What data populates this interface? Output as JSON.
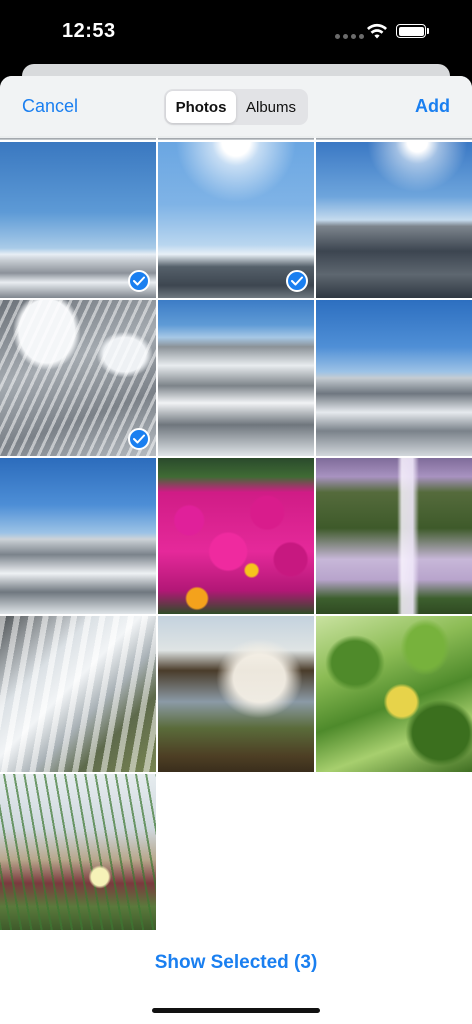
{
  "status_bar": {
    "time": "12:53",
    "icons": [
      "signal-dots-icon",
      "wifi-icon",
      "battery-icon"
    ]
  },
  "nav": {
    "cancel_label": "Cancel",
    "add_label": "Add",
    "segments": [
      {
        "label": "Photos",
        "selected": true
      },
      {
        "label": "Albums",
        "selected": false
      }
    ]
  },
  "photos": [
    {
      "subject": "winter aerial sky",
      "selected": true
    },
    {
      "subject": "winter aerial sun",
      "selected": true
    },
    {
      "subject": "snowy forest horizon",
      "selected": false
    },
    {
      "subject": "snowy forest river",
      "selected": true
    },
    {
      "subject": "aerial snowy fields",
      "selected": false
    },
    {
      "subject": "aerial snowy valley",
      "selected": false
    },
    {
      "subject": "aerial snowy town",
      "selected": false
    },
    {
      "subject": "pink flowers",
      "selected": false
    },
    {
      "subject": "waterfall cliff",
      "selected": false
    },
    {
      "subject": "waterfall mossy rocks",
      "selected": false
    },
    {
      "subject": "waterfall sunset",
      "selected": false
    },
    {
      "subject": "green leaves",
      "selected": false
    },
    {
      "subject": "grass with yellow flower",
      "selected": false
    }
  ],
  "footer": {
    "show_selected_label": "Show Selected (3)"
  },
  "colors": {
    "accent": "#1a7ff0",
    "status_bar_bg": "#000000",
    "nav_bg": "#f0f2f4"
  }
}
